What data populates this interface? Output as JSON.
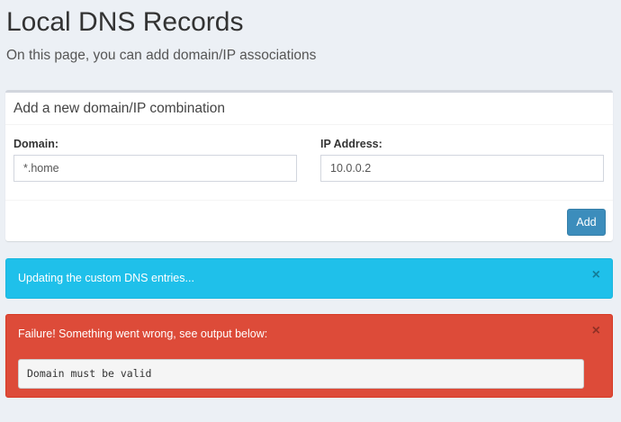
{
  "page": {
    "title": "Local DNS Records",
    "subtitle": "On this page, you can add domain/IP associations"
  },
  "form": {
    "title": "Add a new domain/IP combination",
    "domain_label": "Domain:",
    "domain_value": "*.home",
    "ip_label": "IP Address:",
    "ip_value": "10.0.0.2",
    "add_label": "Add"
  },
  "alerts": {
    "info_text": "Updating the custom DNS entries...",
    "error_text": "Failure! Something went wrong, see output below:",
    "error_output": "Domain must be valid",
    "close_glyph": "×"
  },
  "colors": {
    "background": "#ecf0f5",
    "primary": "#3c8dbc",
    "info": "#1fc0ea",
    "danger": "#dd4b39"
  }
}
